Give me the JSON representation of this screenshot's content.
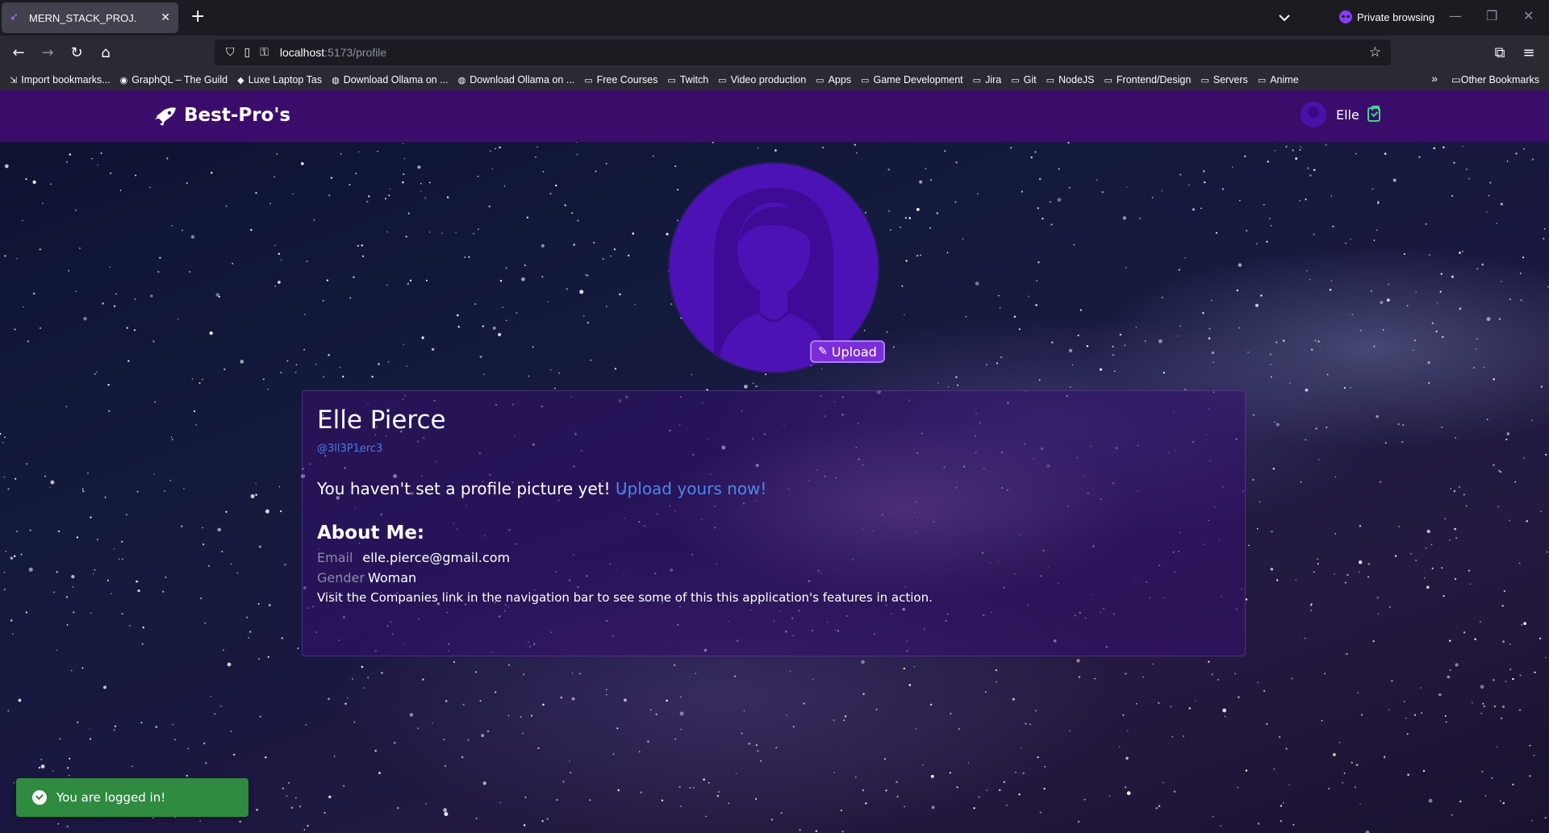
{
  "browser": {
    "tab_title": "MERN_STACK_PROJ.",
    "new_tab_label": "+",
    "private_label": "Private browsing",
    "url_host": "localhost",
    "url_path": ":5173/profile",
    "bookmarks": [
      {
        "label": "Import bookmarks...",
        "icon": "import-icon"
      },
      {
        "label": "GraphQL – The Guild",
        "icon": "graphql-icon"
      },
      {
        "label": "Luxe Laptop Tas",
        "icon": "bol-icon"
      },
      {
        "label": "Download Ollama on ...",
        "icon": "ollama-icon"
      },
      {
        "label": "Download Ollama on ...",
        "icon": "ollama-icon"
      },
      {
        "label": "Free Courses",
        "icon": "folder-icon"
      },
      {
        "label": "Twitch",
        "icon": "folder-icon"
      },
      {
        "label": "Video production",
        "icon": "folder-icon"
      },
      {
        "label": "Apps",
        "icon": "folder-icon"
      },
      {
        "label": "Game Development",
        "icon": "folder-icon"
      },
      {
        "label": "Jira",
        "icon": "folder-icon"
      },
      {
        "label": "Git",
        "icon": "folder-icon"
      },
      {
        "label": "NodeJS",
        "icon": "folder-icon"
      },
      {
        "label": "Frontend/Design",
        "icon": "folder-icon"
      },
      {
        "label": "Servers",
        "icon": "folder-icon"
      },
      {
        "label": "Anime",
        "icon": "folder-icon"
      }
    ],
    "other_bookmarks": "Other Bookmarks"
  },
  "app": {
    "brand": "Best-Pro's",
    "user_name": "Elle",
    "upload_label": "Upload",
    "profile": {
      "full_name": "Elle Pierce",
      "handle": "@3ll3P1erc3",
      "prompt_text": "You haven't set a profile picture yet! ",
      "prompt_link": "Upload yours now!",
      "about_heading": "About Me:",
      "email_label": "Email",
      "email": "elle.pierce@gmail.com",
      "gender_label": "Gender",
      "gender": "Woman",
      "note": "Visit the Companies link in the navigation bar to see some of this this application's features in action."
    },
    "toast": "You are logged in!"
  },
  "colors": {
    "nav_bg": "#3b0d6b",
    "accent": "#7b2dd8",
    "link": "#4d86ee",
    "toast_bg": "#2e8b3f"
  }
}
